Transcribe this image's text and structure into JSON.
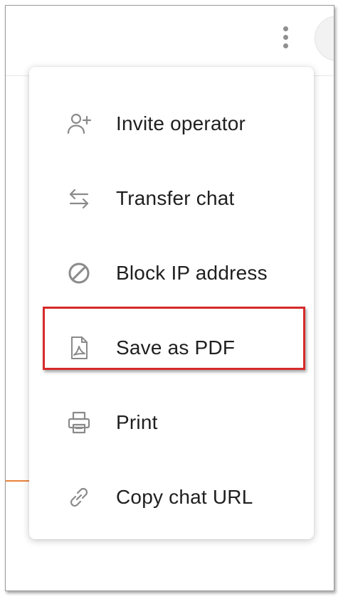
{
  "menu": {
    "items": [
      {
        "label": "Invite operator",
        "icon": "add-user-icon"
      },
      {
        "label": "Transfer chat",
        "icon": "transfer-arrows-icon"
      },
      {
        "label": "Block IP address",
        "icon": "block-icon"
      },
      {
        "label": "Save as PDF",
        "icon": "pdf-file-icon"
      },
      {
        "label": "Print",
        "icon": "printer-icon"
      },
      {
        "label": "Copy chat URL",
        "icon": "link-icon"
      }
    ],
    "highlighted_item": "Save as PDF"
  },
  "colors": {
    "highlight_border": "#d62a2a",
    "accent_line": "#e8823a",
    "icon": "#8a8a8a",
    "text": "#1f1f1f"
  }
}
